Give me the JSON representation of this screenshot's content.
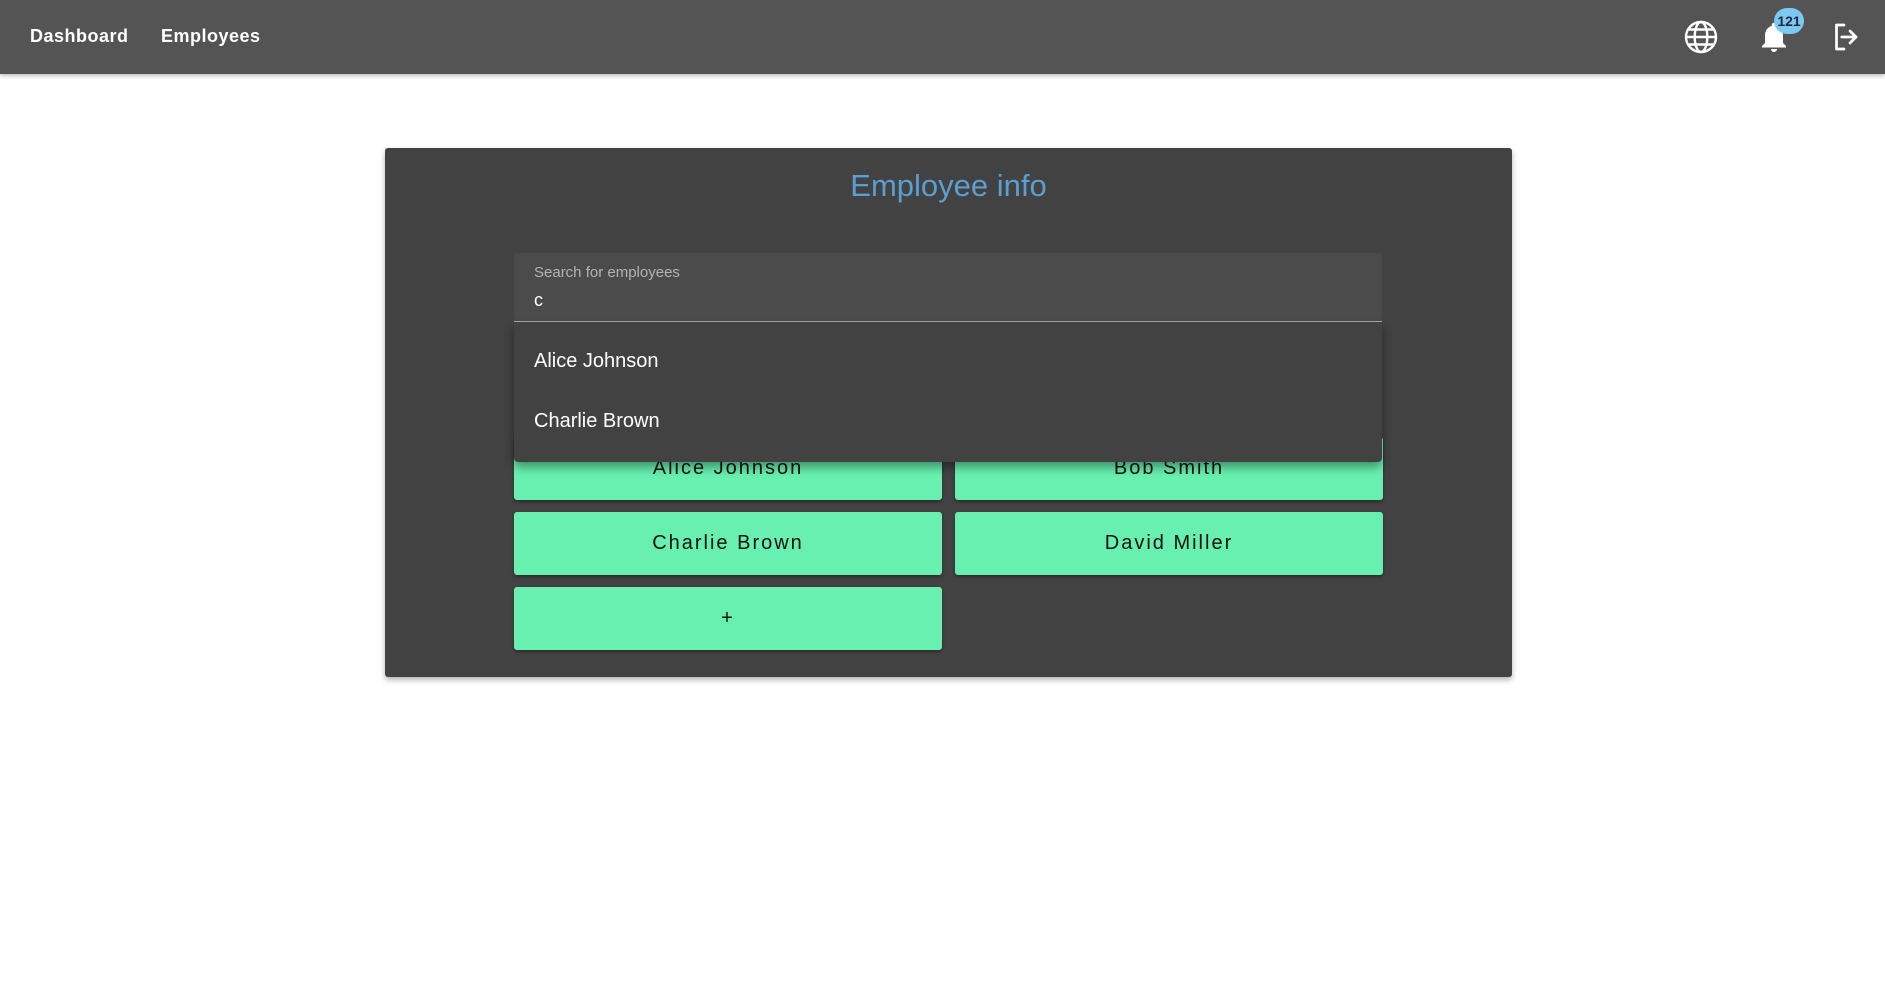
{
  "nav": {
    "dashboard": "Dashboard",
    "employees": "Employees"
  },
  "toolbar": {
    "language_icon": "globe-icon",
    "notifications_icon": "bell-icon",
    "notification_count": "121",
    "logout_icon": "logout-icon"
  },
  "panel": {
    "title": "Employee info"
  },
  "search": {
    "label": "Search for employees",
    "value": "c"
  },
  "suggestions": [
    "Alice Johnson",
    "Charlie Brown"
  ],
  "employees": [
    "Alice Johnson",
    "Bob Smith",
    "Charlie Brown",
    "David Miller"
  ],
  "add_button": "+",
  "colors": {
    "topbar": "#545454",
    "panel": "#424242",
    "accent_title": "#5a9fd0",
    "employee_button": "#68f0b0",
    "badge": "#7cc8f3"
  }
}
